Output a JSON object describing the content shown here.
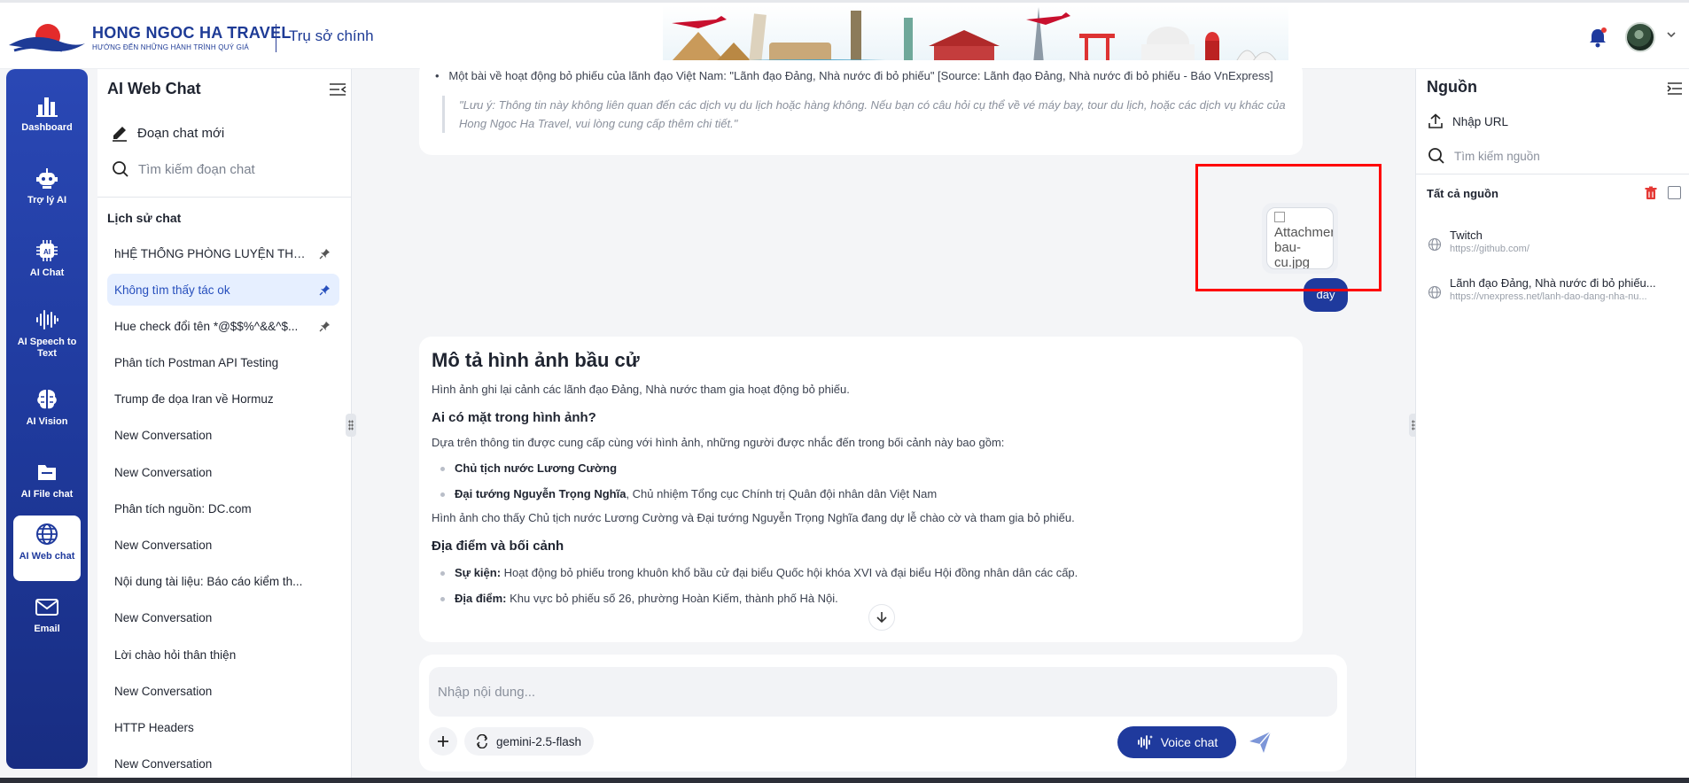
{
  "header": {
    "brand_name": "HONG NGOC HA TRAVEL",
    "brand_tagline": "HƯỚNG ĐẾN NHỮNG HÀNH TRÌNH QUÝ GIÁ",
    "hq_label": "Trụ sở chính"
  },
  "nav": [
    {
      "label": "Dashboard",
      "icon": "bar-chart-icon"
    },
    {
      "label": "Trợ lý AI",
      "icon": "robot-icon"
    },
    {
      "label": "AI Chat",
      "icon": "ai-chip-icon"
    },
    {
      "label": "AI Speech to Text",
      "icon": "waveform-icon"
    },
    {
      "label": "AI Vision",
      "icon": "brain-icon"
    },
    {
      "label": "AI File chat",
      "icon": "folder-icon"
    },
    {
      "label": "AI Web chat",
      "icon": "globe-icon",
      "active": true
    },
    {
      "label": "Email",
      "icon": "mail-icon"
    }
  ],
  "chat_panel": {
    "title": "AI Web Chat",
    "new_chat": "Đoạn chat mới",
    "search_placeholder": "Tìm kiếm đoạn chat",
    "history_label": "Lịch sử chat",
    "items": [
      {
        "label": "hHỆ THỐNG PHÒNG LUYỆN THI ...",
        "pinned": true
      },
      {
        "label": "Không tìm thấy tác ok",
        "pinned": true,
        "active": true
      },
      {
        "label": "Hue check đổi tên *@$$%^&&^$...",
        "pinned": true
      },
      {
        "label": "Phân tích Postman API Testing"
      },
      {
        "label": "Trump đe dọa Iran về Hormuz"
      },
      {
        "label": "New Conversation"
      },
      {
        "label": "New Conversation"
      },
      {
        "label": "Phân tích nguồn: DC.com"
      },
      {
        "label": "New Conversation"
      },
      {
        "label": "Nội dung tài liệu: Báo cáo kiểm th..."
      },
      {
        "label": "New Conversation"
      },
      {
        "label": "Lời chào hỏi thân thiện"
      },
      {
        "label": "New Conversation"
      },
      {
        "label": "HTTP Headers"
      },
      {
        "label": "New Conversation"
      }
    ]
  },
  "conversation": {
    "prev_bullet": "Một bài về hoạt động bỏ phiếu của lãnh đạo Việt Nam: \"Lãnh đạo Đảng, Nhà nước đi bỏ phiếu\" [Source: Lãnh đạo Đảng, Nhà nước đi bỏ phiếu - Báo VnExpress]",
    "prev_note": "\"Lưu ý: Thông tin này không liên quan đến các dịch vụ du lịch hoặc hàng không. Nếu bạn có câu hỏi cụ thể về vé máy bay, tour du lịch, hoặc các dịch vụ khác của Hong Ngoc Ha Travel, vui lòng cung cấp thêm chi tiết.\"",
    "attachment_alt_1": "Attachmen",
    "attachment_alt_2": "bau-",
    "attachment_alt_3": "cu.jpg",
    "user_message": "đây",
    "answer": {
      "title": "Mô tả hình ảnh bầu cử",
      "intro": "Hình ảnh ghi lại cảnh các lãnh đạo Đảng, Nhà nước tham gia hoạt động bỏ phiếu.",
      "h_who": "Ai có mặt trong hình ảnh?",
      "who_intro": "Dựa trên thông tin được cung cấp cùng với hình ảnh, những người được nhắc đến trong bối cảnh này bao gồm:",
      "who_1_bold": "Chủ tịch nước Lương Cường",
      "who_2_bold": "Đại tướng Nguyễn Trọng Nghĩa",
      "who_2_rest": ", Chủ nhiệm Tổng cục Chính trị Quân đội nhân dân Việt Nam",
      "who_summary": "Hình ảnh cho thấy Chủ tịch nước Lương Cường và Đại tướng Nguyễn Trọng Nghĩa đang dự lễ chào cờ và tham gia bỏ phiếu.",
      "h_place": "Địa điểm và bối cảnh",
      "event_bold": "Sự kiện:",
      "event_rest": " Hoạt động bỏ phiếu trong khuôn khổ bầu cử đại biểu Quốc hội khóa XVI và đại biểu Hội đồng nhân dân các cấp.",
      "place_bold": "Địa điểm:",
      "place_rest": " Khu vực bỏ phiếu số 26, phường Hoàn Kiếm, thành phố Hà Nội."
    }
  },
  "composer": {
    "placeholder": "Nhập nội dung...",
    "model": "gemini-2.5-flash",
    "voice_label": "Voice chat"
  },
  "sources": {
    "title": "Nguồn",
    "import_url": "Nhập URL",
    "search_placeholder": "Tìm kiếm nguồn",
    "all_label": "Tất cả nguồn",
    "items": [
      {
        "name": "Twitch",
        "url": "https://github.com/"
      },
      {
        "name": "Lãnh đạo Đảng, Nhà nước đi bỏ phiếu...",
        "url": "https://vnexpress.net/lanh-dao-dang-nha-nu..."
      }
    ]
  },
  "colors": {
    "brand_blue": "#1f3a9d",
    "highlight_red": "#ff0000",
    "active_item_bg": "#e6efff",
    "trash_red": "#e53935"
  }
}
